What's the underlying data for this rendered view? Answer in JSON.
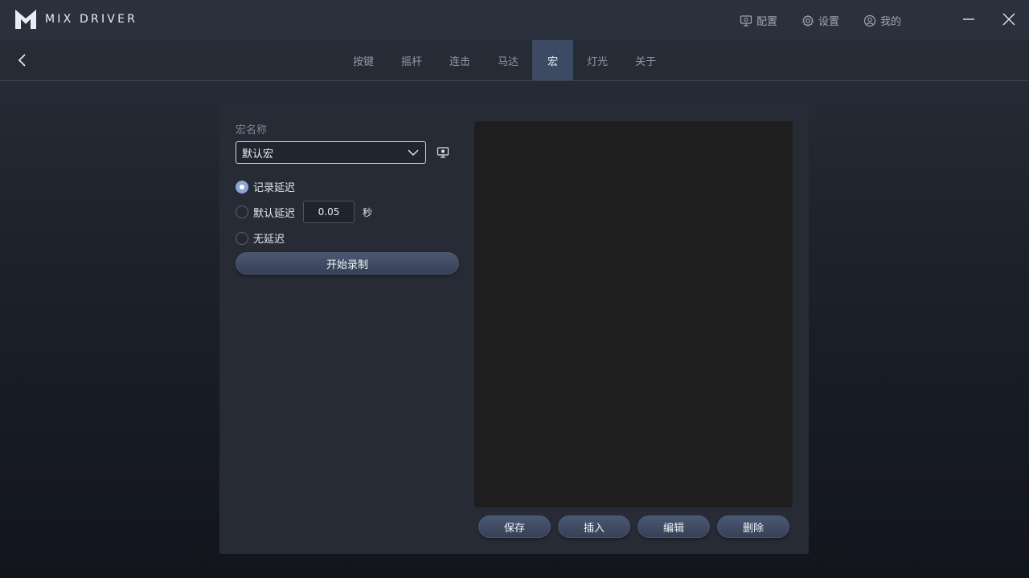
{
  "app": {
    "logo_text": "MIX DRIVER",
    "logo_icon": "mix-driver-logo"
  },
  "titlebar": {
    "actions": [
      {
        "label": "配置",
        "icon": "config-icon"
      },
      {
        "label": "设置",
        "icon": "gear-icon"
      },
      {
        "label": "我的",
        "icon": "user-icon"
      }
    ],
    "window_controls": [
      "minimize-icon",
      "close-icon"
    ]
  },
  "nav": {
    "back_icon": "chevron-left-icon",
    "tabs": [
      {
        "label": "按键",
        "active": false
      },
      {
        "label": "摇杆",
        "active": false
      },
      {
        "label": "连击",
        "active": false
      },
      {
        "label": "马达",
        "active": false
      },
      {
        "label": "宏",
        "active": true
      },
      {
        "label": "灯光",
        "active": false
      },
      {
        "label": "关于",
        "active": false
      }
    ]
  },
  "macro": {
    "name_label": "宏名称",
    "selected_name": "默认宏",
    "monitor_icon": "monitor-icon",
    "delay_options": [
      {
        "label": "记录延迟",
        "checked": true
      },
      {
        "label": "默认延迟",
        "checked": false
      },
      {
        "label": "无延迟",
        "checked": false
      }
    ],
    "default_delay_value": "0.05",
    "delay_unit": "秒",
    "record_button": "开始录制",
    "actions": {
      "save": "保存",
      "insert": "插入",
      "edit": "编辑",
      "delete": "删除"
    }
  },
  "colors": {
    "accent": "#8ea6d6",
    "tab_active_bg": "#3c4a64",
    "panel_bg": "#262b35",
    "list_bg": "#1e1e1e"
  }
}
